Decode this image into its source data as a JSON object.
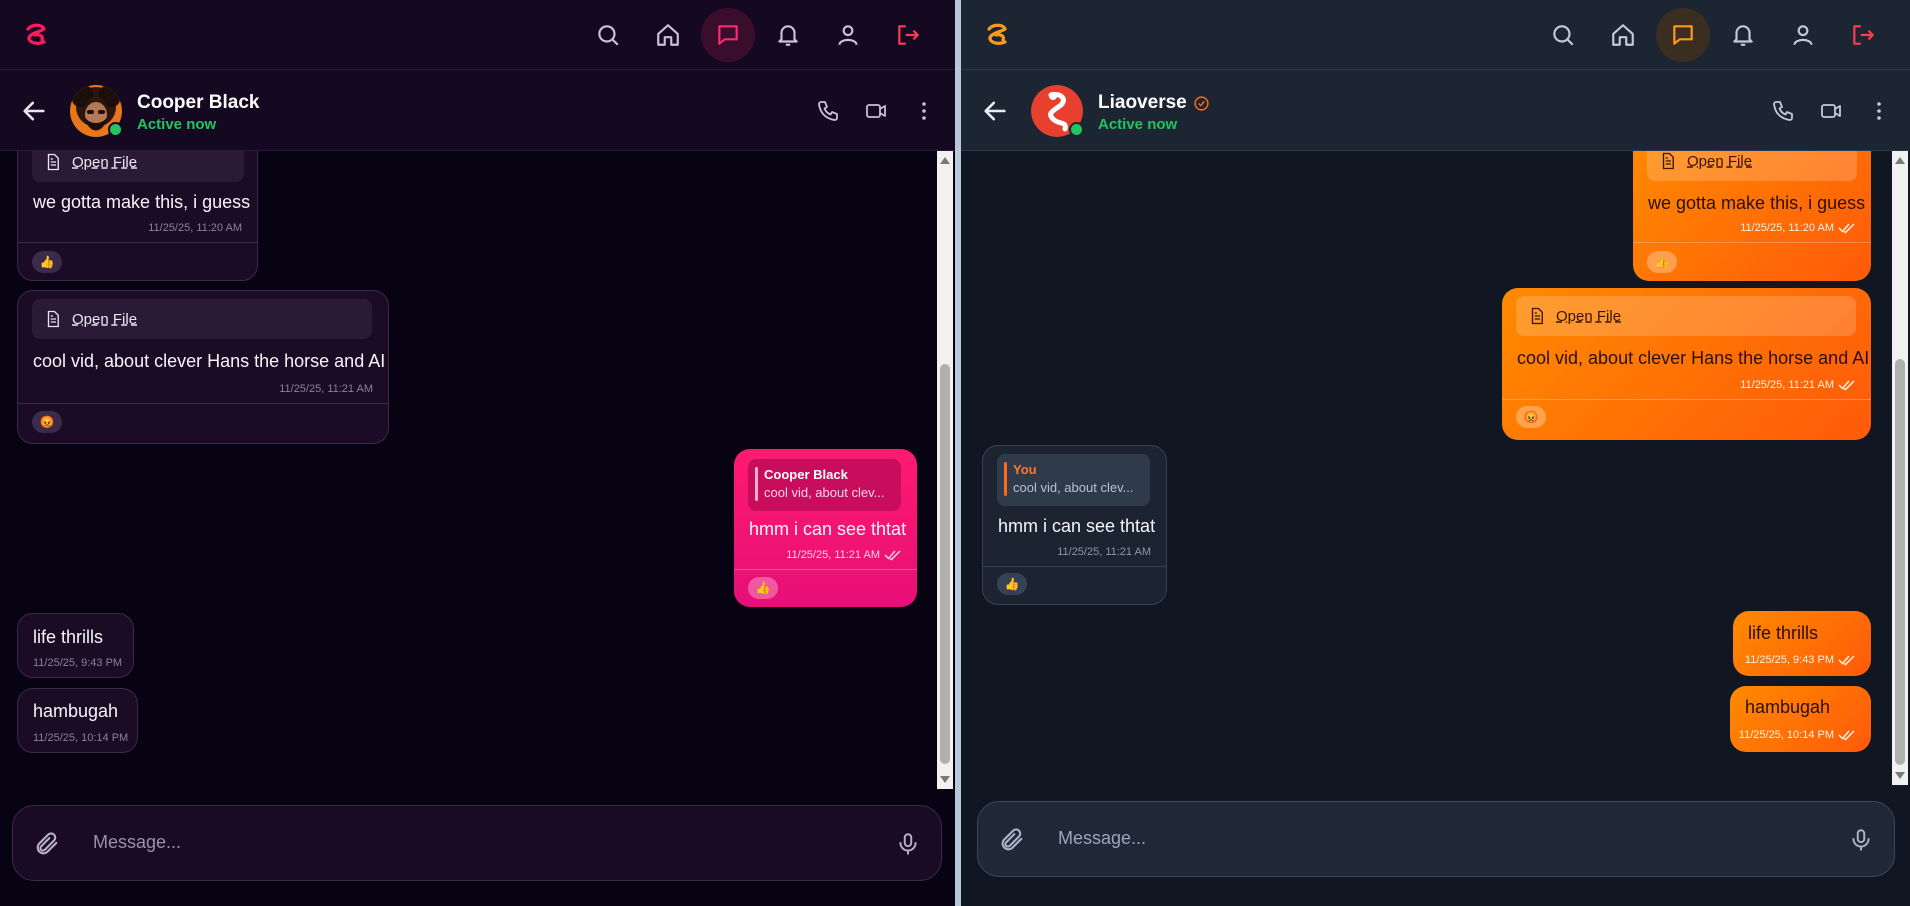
{
  "icons": {
    "logo": "logo-mark-icon",
    "search": "search-icon",
    "home": "home-icon",
    "chat": "chat-icon",
    "bell": "bell-icon",
    "user": "user-icon",
    "logout": "logout-icon",
    "back": "arrow-left-icon",
    "phone": "phone-icon",
    "video": "video-icon",
    "more": "more-vertical-icon",
    "file": "file-icon",
    "attach": "paperclip-icon",
    "mic": "mic-icon",
    "read": "double-check-icon",
    "verified": "verified-badge-icon"
  },
  "colors": {
    "left_accent": "#ff1a6e",
    "right_accent": "#ff8a00",
    "online": "#22c55e",
    "logout": "#ff3b4f"
  },
  "left": {
    "contact": {
      "name": "Cooper Black",
      "status": "Active now"
    },
    "messages": [
      {
        "file_label": "Open File",
        "text": "we gotta make this, i guess",
        "time": "11/25/25, 11:20 AM",
        "reaction": "👍"
      },
      {
        "file_label": "Open File",
        "text": "cool vid, about clever Hans the horse and AI",
        "time": "11/25/25, 11:21 AM",
        "reaction": "😡"
      },
      {
        "quote_author": "Cooper Black",
        "quote_text": "cool vid, about clev...",
        "text": "hmm i can see thtat",
        "time": "11/25/25, 11:21 AM",
        "reaction": "👍"
      },
      {
        "text": "life thrills",
        "time": "11/25/25, 9:43 PM"
      },
      {
        "text": "hambugah",
        "time": "11/25/25, 10:14 PM"
      }
    ],
    "composer": {
      "placeholder": "Message..."
    }
  },
  "right": {
    "contact": {
      "name": "Liaoverse",
      "status": "Active now"
    },
    "messages": [
      {
        "file_label": "Open File",
        "text": "we gotta make this, i guess",
        "time": "11/25/25, 11:20 AM",
        "reaction": "👍"
      },
      {
        "file_label": "Open File",
        "text": "cool vid, about clever Hans the horse and AI",
        "time": "11/25/25, 11:21 AM",
        "reaction": "😡"
      },
      {
        "quote_author": "You",
        "quote_text": "cool vid, about clev...",
        "text": "hmm i can see thtat",
        "time": "11/25/25, 11:21 AM",
        "reaction": "👍"
      },
      {
        "text": "life thrills",
        "time": "11/25/25, 9:43 PM"
      },
      {
        "text": "hambugah",
        "time": "11/25/25, 10:14 PM"
      }
    ],
    "composer": {
      "placeholder": "Message..."
    }
  }
}
